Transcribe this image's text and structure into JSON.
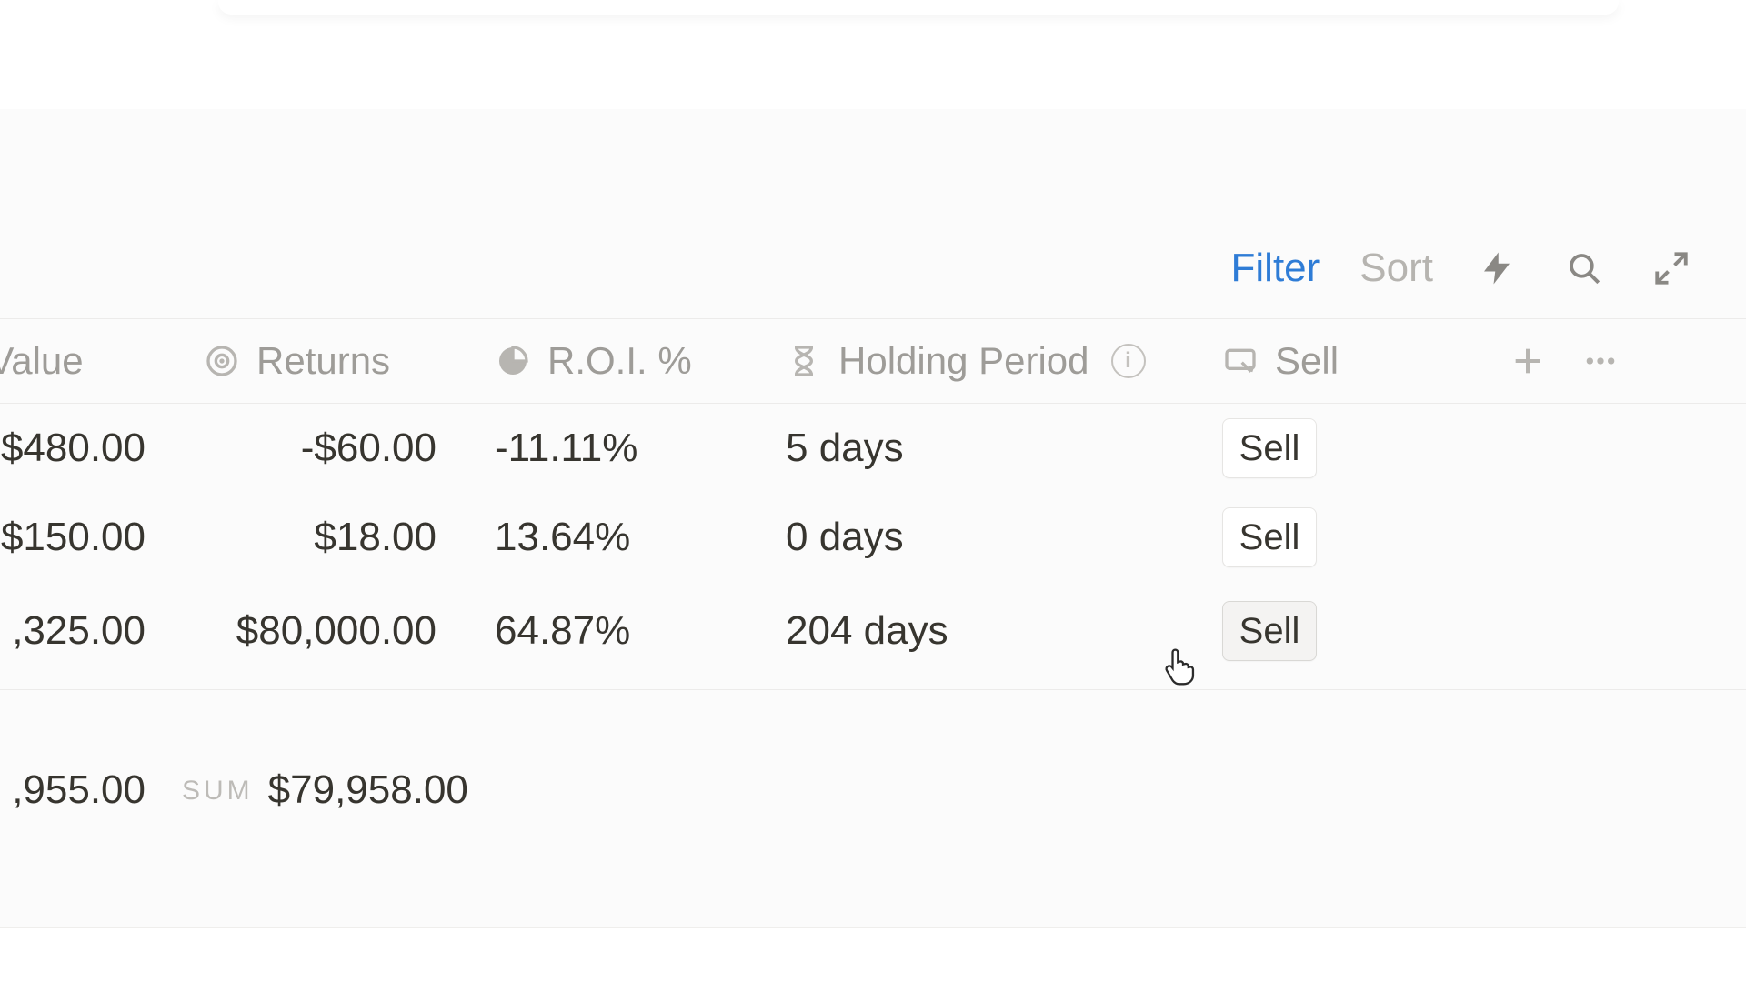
{
  "toolbar": {
    "filter_label": "Filter",
    "sort_label": "Sort"
  },
  "columns": {
    "value": "t Value",
    "returns": "Returns",
    "roi": "R.O.I. %",
    "holding": "Holding Period",
    "sell": "Sell"
  },
  "rows": [
    {
      "value": "$480.00",
      "returns": "-$60.00",
      "roi": "-11.11%",
      "holding": "5 days",
      "sell": "Sell"
    },
    {
      "value": "$150.00",
      "returns": "$18.00",
      "roi": "13.64%",
      "holding": "0 days",
      "sell": "Sell"
    },
    {
      "value": ",325.00",
      "returns": "$80,000.00",
      "roi": "64.87%",
      "holding": "204 days",
      "sell": "Sell"
    }
  ],
  "summary": {
    "value_sum": ",955.00",
    "returns_sum_label": "SUM",
    "returns_sum": "$79,958.00"
  }
}
